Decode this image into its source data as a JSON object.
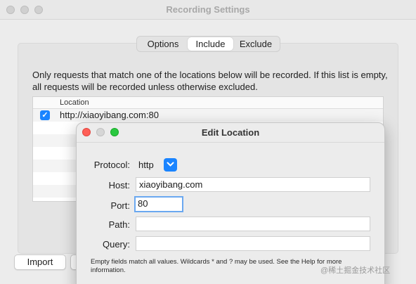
{
  "window": {
    "title": "Recording Settings"
  },
  "tabs": [
    {
      "label": "Options",
      "active": false
    },
    {
      "label": "Include",
      "active": true
    },
    {
      "label": "Exclude",
      "active": false
    }
  ],
  "description": "Only requests that match one of the locations below will be recorded. If this list is empty, all requests will be recorded unless otherwise excluded.",
  "table": {
    "column_header": "Location",
    "rows": [
      {
        "checked": true,
        "location": "http://xiaoyibang.com:80"
      }
    ]
  },
  "buttons": {
    "import": "Import"
  },
  "dialog": {
    "title": "Edit Location",
    "protocol": {
      "label": "Protocol:",
      "value": "http"
    },
    "host": {
      "label": "Host:",
      "value": "xiaoyibang.com"
    },
    "port": {
      "label": "Port:",
      "value": "80"
    },
    "path": {
      "label": "Path:",
      "value": ""
    },
    "query": {
      "label": "Query:",
      "value": ""
    },
    "hint": "Empty fields match all values. Wildcards * and ? may be used. See the Help for more information."
  },
  "watermark": "@稀土掘金技术社区",
  "colors": {
    "accent": "#1a84ff",
    "close": "#fe5f57",
    "zoom": "#2ac840",
    "focus_ring": "#6aa8f0"
  }
}
